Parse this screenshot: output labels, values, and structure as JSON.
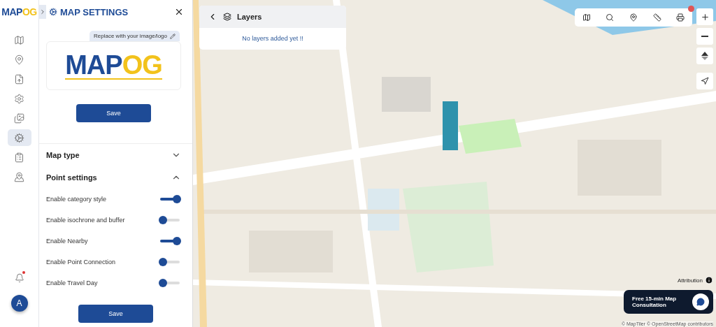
{
  "brand": {
    "main": "MAP",
    "accent": "OG"
  },
  "rail": {
    "items": [
      {
        "selected": false
      },
      {
        "selected": false
      },
      {
        "selected": false
      },
      {
        "selected": false
      },
      {
        "selected": false
      },
      {
        "selected": true
      },
      {
        "selected": false
      },
      {
        "selected": false
      }
    ],
    "notifications": {
      "unread": true
    },
    "avatar": "A"
  },
  "panel": {
    "title": "MAP SETTINGS",
    "replace_label": "Replace with your image/logo",
    "logo": {
      "main": "MAP",
      "accent": "OG"
    },
    "save_top": "Save",
    "sections": [
      {
        "title": "Map type",
        "expanded": false
      },
      {
        "title": "Point settings",
        "expanded": true
      }
    ],
    "toggles": [
      {
        "label": "Enable category style",
        "on": true
      },
      {
        "label": "Enable isochrone and buffer",
        "on": false
      },
      {
        "label": "Enable Nearby",
        "on": true
      },
      {
        "label": "Enable Point Connection",
        "on": false
      },
      {
        "label": "Enable Travel Day",
        "on": false
      }
    ],
    "save_bottom": "Save"
  },
  "layers": {
    "title": "Layers",
    "empty": "No layers added yet !!"
  },
  "map": {
    "kind": "picture",
    "attribution": "Attribution",
    "copyright": "© MapTiler © OpenStreetMap contributors",
    "consult": "Free 15-min Map Consultation"
  }
}
